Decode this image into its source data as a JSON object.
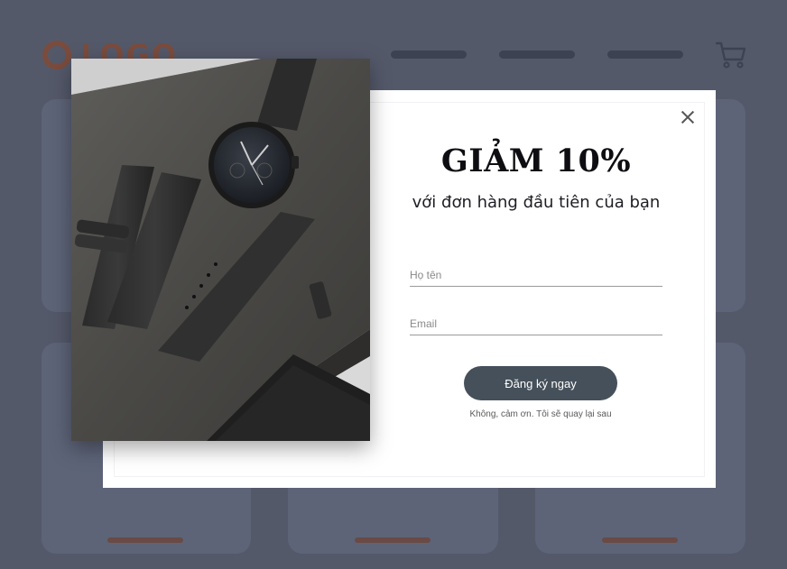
{
  "site": {
    "logo_text": "LOGO",
    "nav_items": 3,
    "cart_icon": "shopping-cart-icon",
    "brand_color": "#7a4c3e"
  },
  "popup": {
    "title": "GIẢM 10%",
    "subtitle": "với đơn hàng đầu tiên của bạn",
    "close_icon": "close-icon",
    "name_placeholder": "Họ tên",
    "email_placeholder": "Email",
    "submit_label": "Đăng ký ngay",
    "decline_label": "Không, cảm ơn. Tôi sẽ quay lại sau",
    "button_color": "#45505a",
    "image": "watch-product-photo"
  }
}
